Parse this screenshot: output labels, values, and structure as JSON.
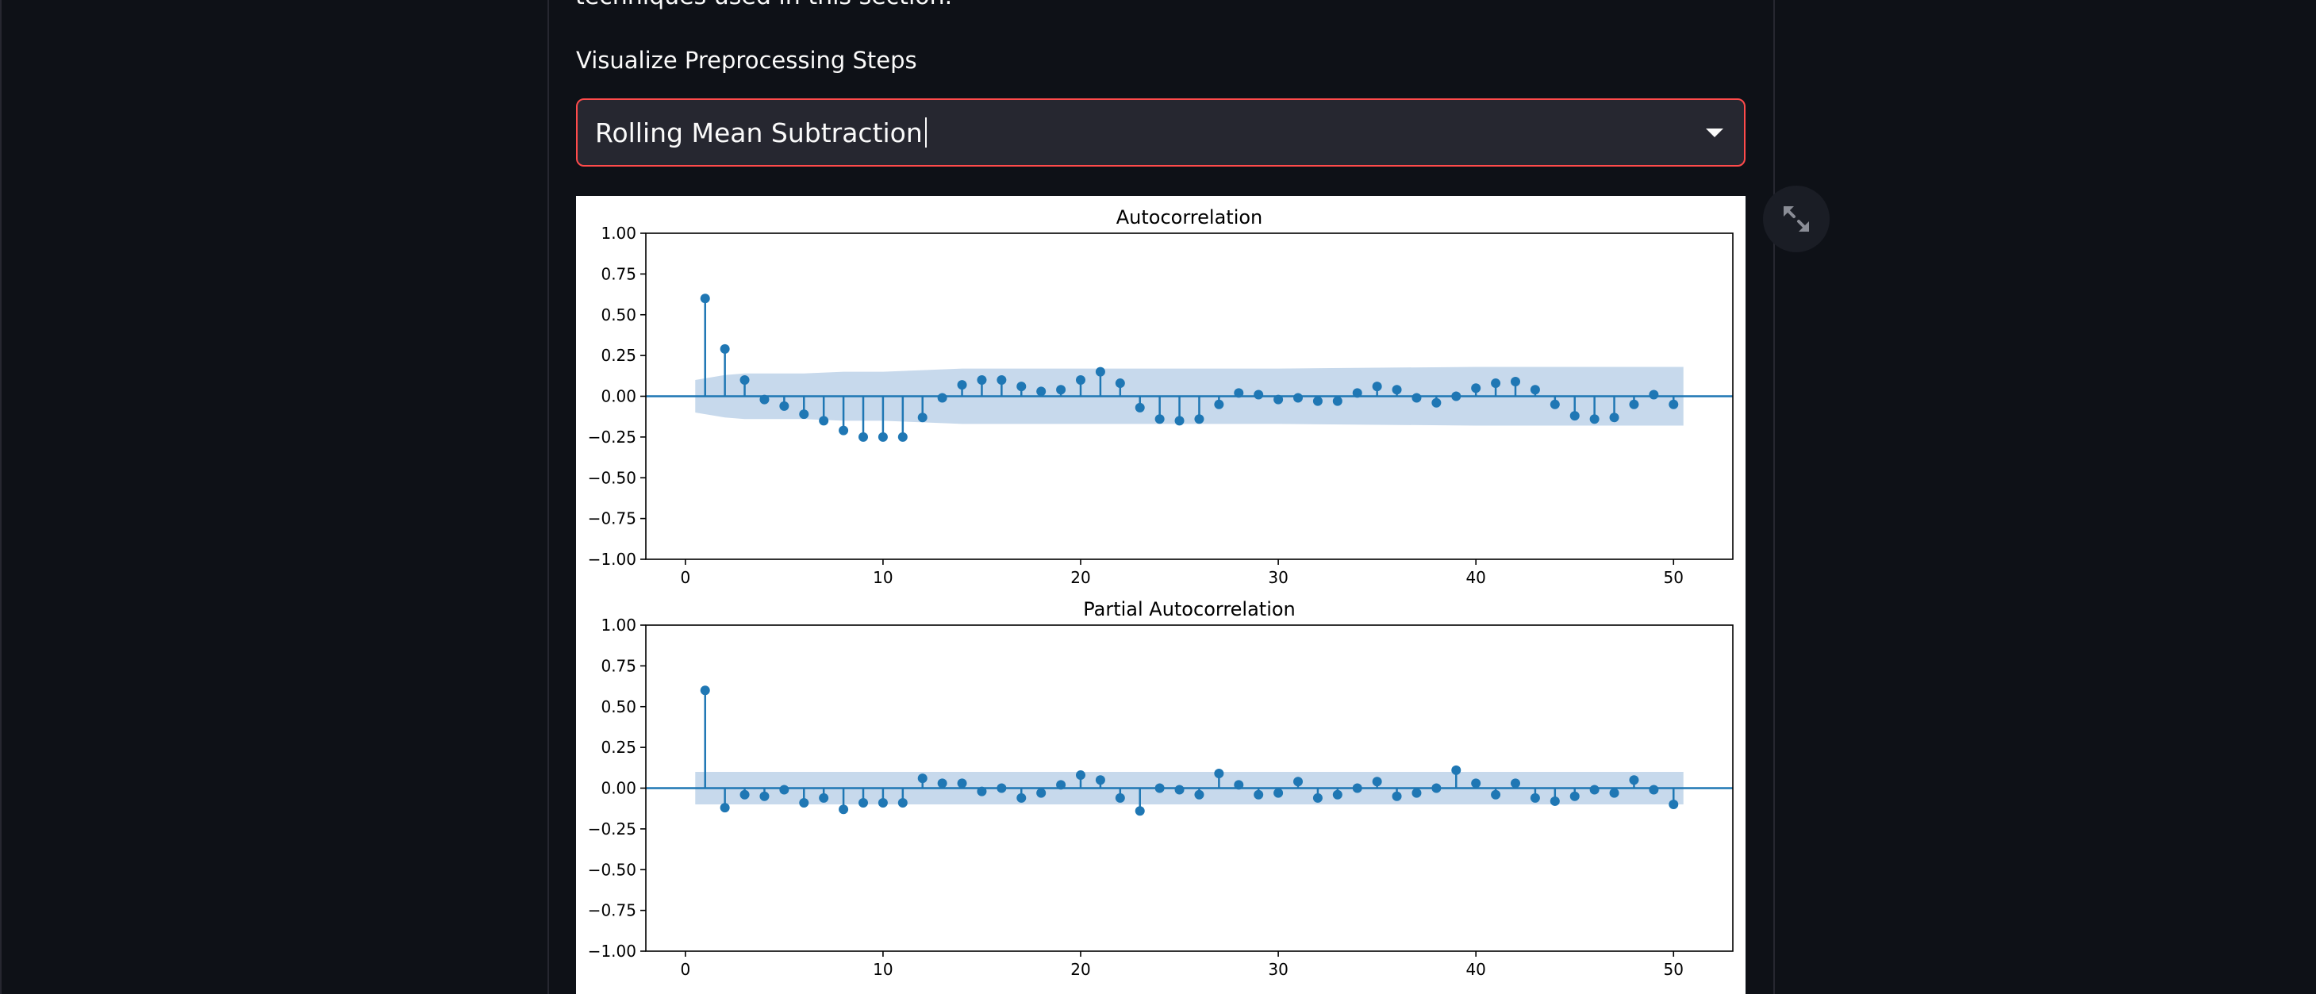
{
  "intro_text": "techniques used in this section.",
  "select": {
    "label": "Visualize Preprocessing Steps",
    "value": "Rolling Mean Subtraction"
  },
  "expand_icon": "expand-arrows-icon",
  "colors": {
    "background": "#0e1117",
    "accent_border": "#ff4b4b",
    "input_bg": "#262730",
    "stem": "#1f77b4",
    "confidence_band": "#c7d9ec"
  },
  "chart_data": [
    {
      "type": "stem",
      "title": "Autocorrelation",
      "xlim": [
        -2,
        53
      ],
      "ylim": [
        -1.0,
        1.0
      ],
      "xticks": [
        "0",
        "10",
        "20",
        "30",
        "40",
        "50"
      ],
      "yticks": [
        "1.00",
        "0.75",
        "0.50",
        "0.25",
        "0.00",
        "−0.25",
        "−0.50",
        "−0.75",
        "−1.00"
      ],
      "x": [
        1,
        2,
        3,
        4,
        5,
        6,
        7,
        8,
        9,
        10,
        11,
        12,
        13,
        14,
        15,
        16,
        17,
        18,
        19,
        20,
        21,
        22,
        23,
        24,
        25,
        26,
        27,
        28,
        29,
        30,
        31,
        32,
        33,
        34,
        35,
        36,
        37,
        38,
        39,
        40,
        41,
        42,
        43,
        44,
        45,
        46,
        47,
        48,
        49,
        50
      ],
      "values": [
        0.6,
        0.29,
        0.1,
        -0.02,
        -0.06,
        -0.11,
        -0.15,
        -0.21,
        -0.25,
        -0.25,
        -0.25,
        -0.13,
        -0.01,
        0.07,
        0.1,
        0.1,
        0.06,
        0.03,
        0.04,
        0.1,
        0.15,
        0.08,
        -0.07,
        -0.14,
        -0.15,
        -0.14,
        -0.05,
        0.02,
        0.01,
        -0.02,
        -0.01,
        -0.03,
        -0.03,
        0.02,
        0.06,
        0.04,
        -0.01,
        -0.04,
        0.0,
        0.05,
        0.08,
        0.09,
        0.04,
        -0.05,
        -0.12,
        -0.14,
        -0.13,
        -0.05,
        0.01,
        -0.05
      ],
      "confidence_band": {
        "x": [
          0.5,
          1,
          2,
          3,
          4,
          5,
          6,
          8,
          10,
          12,
          14,
          20,
          30,
          40,
          50,
          50.5
        ],
        "upper": [
          0.1,
          0.11,
          0.13,
          0.14,
          0.14,
          0.14,
          0.14,
          0.15,
          0.15,
          0.16,
          0.17,
          0.17,
          0.17,
          0.18,
          0.18,
          0.18
        ]
      }
    },
    {
      "type": "stem",
      "title": "Partial Autocorrelation",
      "xlim": [
        -2,
        53
      ],
      "ylim": [
        -1.0,
        1.0
      ],
      "xticks": [
        "0",
        "10",
        "20",
        "30",
        "40",
        "50"
      ],
      "yticks": [
        "1.00",
        "0.75",
        "0.50",
        "0.25",
        "0.00",
        "−0.25",
        "−0.50",
        "−0.75",
        "−1.00"
      ],
      "x": [
        1,
        2,
        3,
        4,
        5,
        6,
        7,
        8,
        9,
        10,
        11,
        12,
        13,
        14,
        15,
        16,
        17,
        18,
        19,
        20,
        21,
        22,
        23,
        24,
        25,
        26,
        27,
        28,
        29,
        30,
        31,
        32,
        33,
        34,
        35,
        36,
        37,
        38,
        39,
        40,
        41,
        42,
        43,
        44,
        45,
        46,
        47,
        48,
        49,
        50
      ],
      "values": [
        0.6,
        -0.12,
        -0.04,
        -0.05,
        -0.01,
        -0.09,
        -0.06,
        -0.13,
        -0.09,
        -0.09,
        -0.09,
        0.06,
        0.03,
        0.03,
        -0.02,
        0.0,
        -0.06,
        -0.03,
        0.02,
        0.08,
        0.05,
        -0.06,
        -0.14,
        0.0,
        -0.01,
        -0.04,
        0.09,
        0.02,
        -0.04,
        -0.03,
        0.04,
        -0.06,
        -0.04,
        0.0,
        0.04,
        -0.05,
        -0.03,
        0.0,
        0.11,
        0.03,
        -0.04,
        0.03,
        -0.06,
        -0.08,
        -0.05,
        -0.01,
        -0.03,
        0.05,
        -0.01,
        -0.1
      ],
      "confidence_band": {
        "x": [
          0.5,
          50.5
        ],
        "upper": [
          0.1,
          0.1
        ]
      }
    }
  ]
}
